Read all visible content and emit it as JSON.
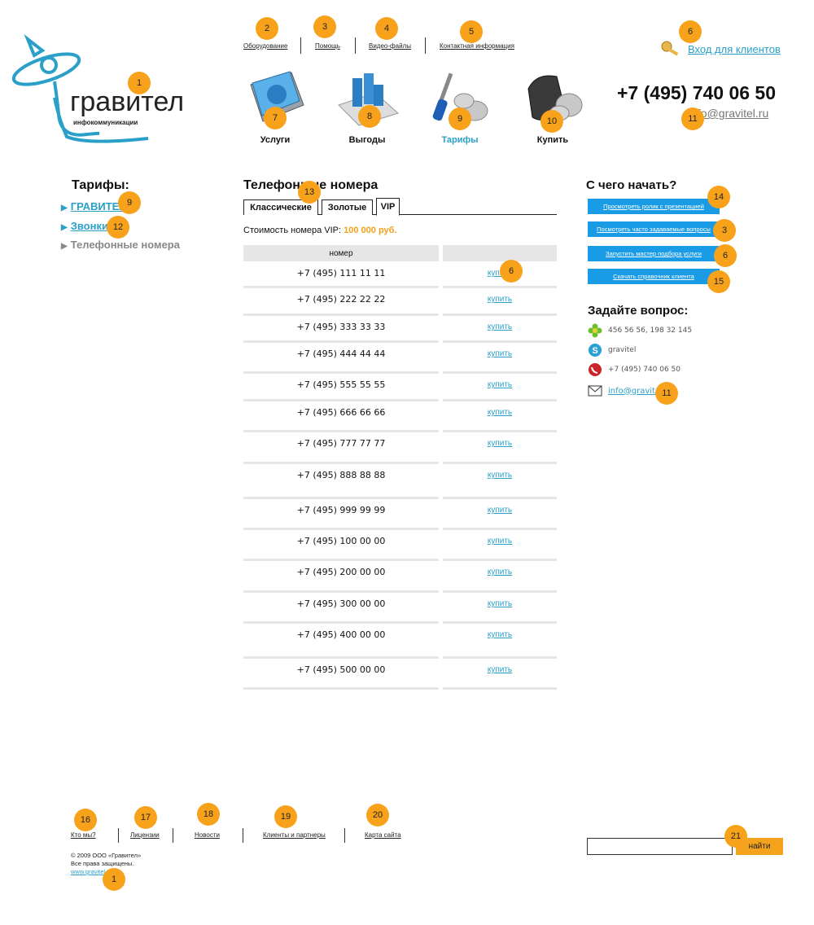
{
  "logo": {
    "name": "гравител",
    "tagline": "инфокоммуникации"
  },
  "top_menu": [
    "Оборудование",
    "Помощь",
    "Видео-файлы",
    "Контактная информация"
  ],
  "login": "Вход для клиентов",
  "phone": "+7 (495) 740 06 50",
  "email_top": "info@gravitel.ru",
  "main_nav": [
    {
      "label": "Услуги",
      "icon": "book-globe-icon"
    },
    {
      "label": "Выгоды",
      "icon": "bar-chart-icon"
    },
    {
      "label": "Тарифы",
      "icon": "screwdriver-coins-icon",
      "active": true
    },
    {
      "label": "Купить",
      "icon": "wallet-coins-icon"
    }
  ],
  "left": {
    "title": "Тарифы:",
    "items": [
      {
        "label": "ГРАВИТЕЛ",
        "link": true
      },
      {
        "label": "Звонки",
        "link": true
      },
      {
        "label": "Телефонные номера",
        "link": false
      }
    ]
  },
  "center": {
    "title": "Телефонные номера",
    "tabs": [
      "Классические",
      "Золотые",
      "VIP"
    ],
    "active_tab": "VIP",
    "cost_label": "Стоимость номера VIP:",
    "cost_value": "100 000 руб.",
    "table_header": "номер",
    "buy_label": "купить",
    "numbers": [
      "+7 (495) 111 11 11",
      "+7 (495) 222 22 22",
      "+7 (495) 333 33 33",
      "+7 (495) 444 44 44",
      "+7 (495) 555 55 55",
      "+7 (495) 666 66 66",
      "+7 (495) 777 77 77",
      "+7 (495) 888 88 88",
      "+7 (495) 999 99 99",
      "+7 (495) 100 00 00",
      "+7 (495) 200 00 00",
      "+7 (495) 300 00 00",
      "+7 (495) 400 00 00",
      "+7 (495) 500 00 00"
    ]
  },
  "right": {
    "title": "С чего начать?",
    "buttons": [
      "Просмотреть ролик с презентацией",
      "Посмотреть часто задаваемые вопросы",
      "Запустить мастер подбора услуги",
      "Скачать справочник клиента"
    ],
    "ask_title": "Задайте вопрос:",
    "contacts": [
      {
        "icon": "icq-flower-icon",
        "text": "456 56 56, 198 32 145"
      },
      {
        "icon": "skype-icon",
        "text": "gravitel"
      },
      {
        "icon": "phone-icon",
        "text": "+7 (495) 740 06 50"
      },
      {
        "icon": "envelope-icon",
        "text": "info@gravitel"
      }
    ]
  },
  "footer": {
    "menu": [
      "Кто мы?",
      "Лицензии",
      "Новости",
      "Клиенты и партнеры",
      "Карта сайта"
    ],
    "copyright": "© 2009 ООО «Гравител»",
    "rights": "Все права защищены.",
    "site": "www.gravitel.ru",
    "search_button": "найти"
  },
  "annotations": [
    "1",
    "2",
    "3",
    "4",
    "5",
    "6",
    "7",
    "8",
    "9",
    "10",
    "11",
    "9",
    "12",
    "13",
    "14",
    "3",
    "6",
    "15",
    "6",
    "11",
    "16",
    "17",
    "18",
    "19",
    "20",
    "1",
    "21"
  ],
  "colors": {
    "accent_blue": "#2aa0c9",
    "button_blue": "#1a9be6",
    "price_orange": "#f0a01b",
    "badge_orange": "#f7a21a"
  }
}
